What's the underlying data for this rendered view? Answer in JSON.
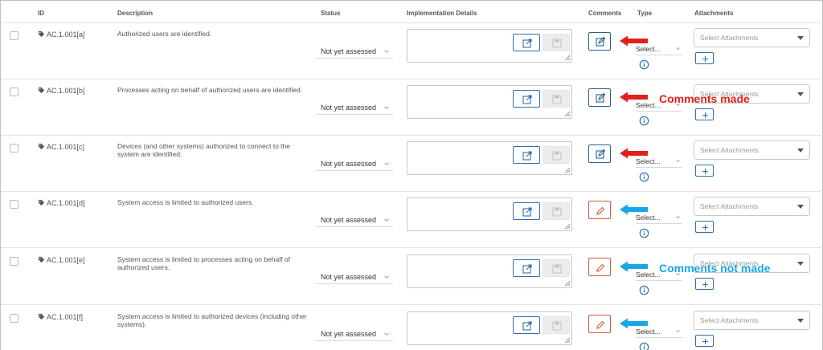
{
  "header": {
    "id": "ID",
    "description": "Description",
    "status": "Status",
    "implementation": "Implementation Details",
    "comments": "Comments",
    "type": "Type",
    "attachments": "Attachments"
  },
  "rows": [
    {
      "id": "AC.1.001[a]",
      "description": "Authorized users are identified.",
      "status": "Not yet assessed",
      "type": "Select...",
      "attachments_placeholder": "Select Attachments",
      "comments_made": true
    },
    {
      "id": "AC.1.001[b]",
      "description": "Processes acting on behalf of authorized users are identified.",
      "status": "Not yet assessed",
      "type": "Select...",
      "attachments_placeholder": "Select Attachments",
      "comments_made": true
    },
    {
      "id": "AC.1.001[c]",
      "description": "Devices (and other systems) authorized to connect to the system are identified.",
      "status": "Not yet assessed",
      "type": "Select...",
      "attachments_placeholder": "Select Attachments",
      "comments_made": true
    },
    {
      "id": "AC.1.001[d]",
      "description": "System access is limited to authorized users.",
      "status": "Not yet assessed",
      "type": "Select...",
      "attachments_placeholder": "Select Attachments",
      "comments_made": false
    },
    {
      "id": "AC.1.001[e]",
      "description": "System access is limited to processes acting on behalf of authorized users.",
      "status": "Not yet assessed",
      "type": "Select...",
      "attachments_placeholder": "Select Attachments",
      "comments_made": false
    },
    {
      "id": "AC.1.001[f]",
      "description": "System access is limited to authorized devices (including other systems).",
      "status": "Not yet assessed",
      "type": "Select...",
      "attachments_placeholder": "Select Attachments",
      "comments_made": false
    }
  ],
  "annotations": {
    "comments_made": "Comments made",
    "comments_not_made": "Comments not made"
  },
  "colors": {
    "accent_blue": "#2f6fa8",
    "comment_made_border": "#2d5f8f",
    "comment_not_made_border": "#d9583f",
    "arrow_red": "#e0211b",
    "arrow_blue": "#19a6e6"
  },
  "icons": {
    "id_tag": "tag-icon",
    "open": "external-link-icon",
    "save": "save-icon",
    "comment_made": "edit-icon",
    "comment_not_made": "pencil-icon",
    "info": "info-icon",
    "add": "plus-icon"
  }
}
